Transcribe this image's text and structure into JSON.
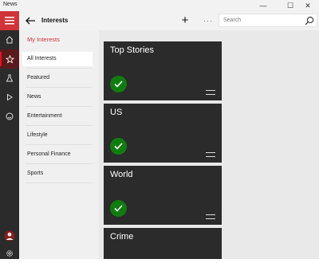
{
  "window": {
    "title": "News",
    "minimize": "—",
    "maximize": "☐",
    "close": "✕"
  },
  "header": {
    "title": "Interests",
    "add_label": "+",
    "more_label": "···",
    "search_placeholder": "Search"
  },
  "left_nav": {
    "icons": [
      "hamburger-icon",
      "home-icon",
      "star-icon",
      "flask-icon",
      "play-icon",
      "smile-icon",
      "avatar",
      "gear-icon"
    ]
  },
  "subnav": {
    "items": [
      {
        "label": "My Interests"
      },
      {
        "label": "All Interests"
      },
      {
        "label": "Featured"
      },
      {
        "label": "News"
      },
      {
        "label": "Entertainment"
      },
      {
        "label": "Lifestyle"
      },
      {
        "label": "Personal Finance"
      },
      {
        "label": "Sports"
      }
    ]
  },
  "tiles": [
    {
      "name": "Top Stories",
      "checked": true
    },
    {
      "name": "US",
      "checked": true
    },
    {
      "name": "World",
      "checked": true
    },
    {
      "name": "Crime",
      "checked": false
    }
  ],
  "colors": {
    "accent": "#d13438",
    "check": "#107c10",
    "tile": "#2b2b2b"
  }
}
